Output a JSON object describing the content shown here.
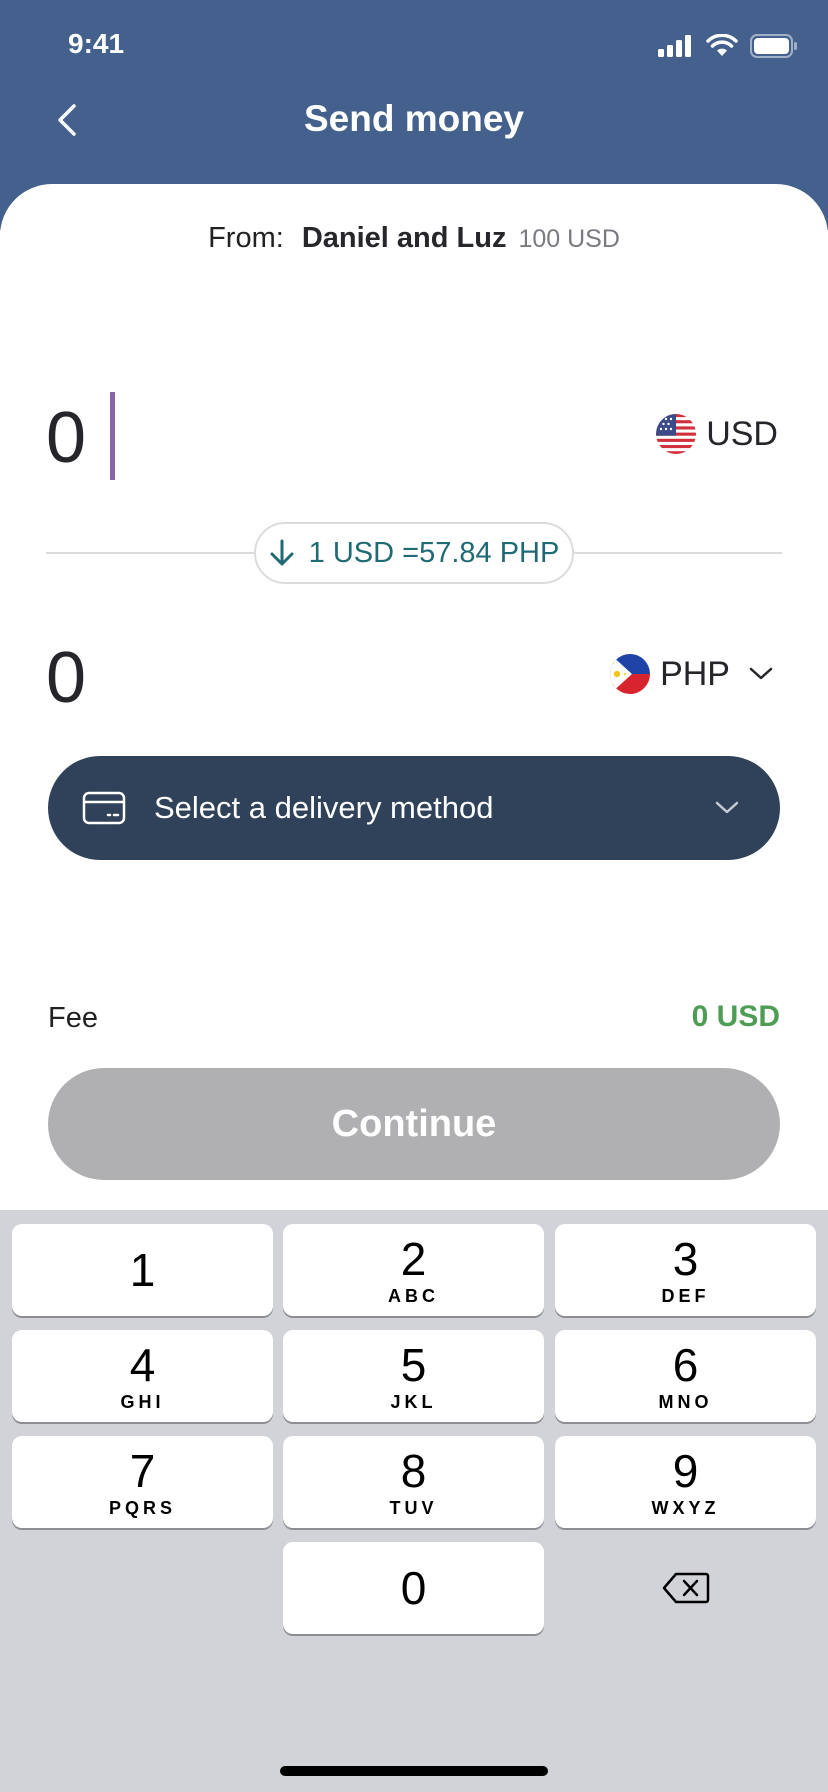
{
  "status_bar": {
    "time": "9:41"
  },
  "header": {
    "title": "Send money"
  },
  "from": {
    "label": "From:",
    "name": "Daniel and Luz",
    "balance": "100 USD"
  },
  "send": {
    "amount": "0",
    "currency": "USD"
  },
  "rate": {
    "text": "1 USD =57.84 PHP"
  },
  "receive": {
    "amount": "0",
    "currency": "PHP"
  },
  "delivery": {
    "label": "Select a delivery method"
  },
  "fee": {
    "label": "Fee",
    "value": "0 USD"
  },
  "continue_label": "Continue",
  "keypad": {
    "keys": [
      {
        "num": "1",
        "sub": ""
      },
      {
        "num": "2",
        "sub": "ABC"
      },
      {
        "num": "3",
        "sub": "DEF"
      },
      {
        "num": "4",
        "sub": "GHI"
      },
      {
        "num": "5",
        "sub": "JKL"
      },
      {
        "num": "6",
        "sub": "MNO"
      },
      {
        "num": "7",
        "sub": "PQRS"
      },
      {
        "num": "8",
        "sub": "TUV"
      },
      {
        "num": "9",
        "sub": "WXYZ"
      },
      {
        "num": "0",
        "sub": ""
      }
    ]
  },
  "colors": {
    "header": "#43618c",
    "delivery_button": "#2f4259",
    "fee_value": "#4e9d54",
    "rate_text": "#1f6a73",
    "cursor": "#8b64a8",
    "continue_disabled": "#b0b0b2"
  }
}
